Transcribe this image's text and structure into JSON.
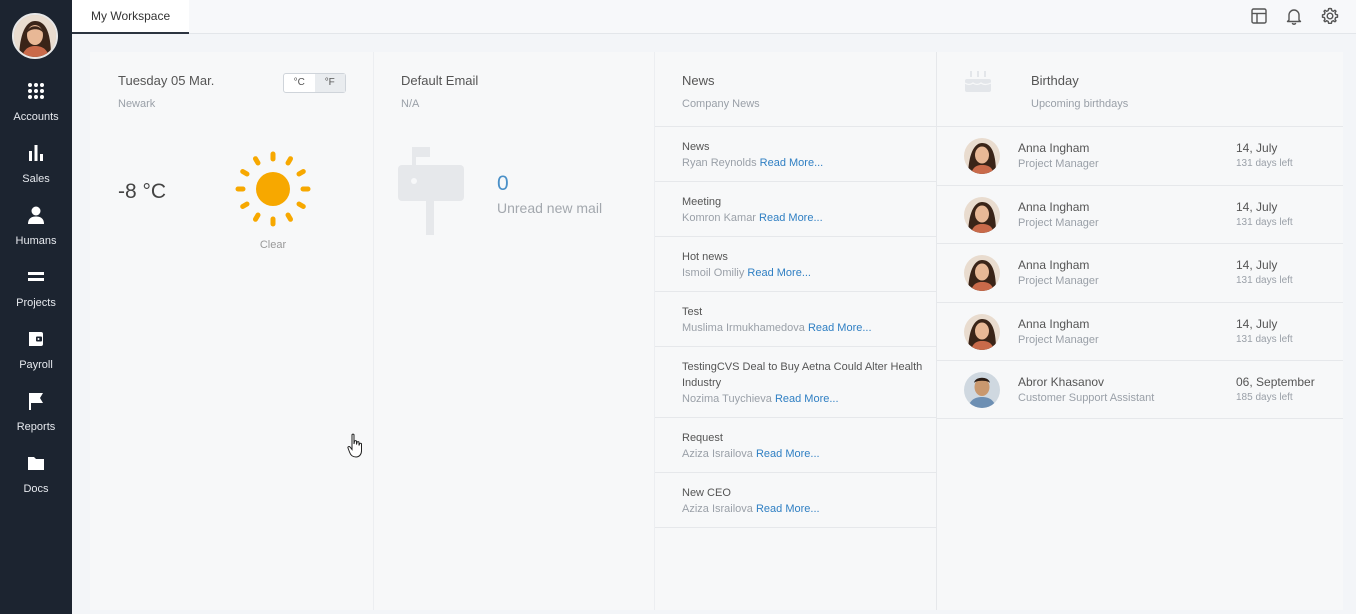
{
  "sidebar": {
    "items": [
      {
        "label": "Accounts",
        "icon": "grid-icon"
      },
      {
        "label": "Sales",
        "icon": "bar-chart-icon"
      },
      {
        "label": "Humans",
        "icon": "person-icon"
      },
      {
        "label": "Projects",
        "icon": "equals-icon"
      },
      {
        "label": "Payroll",
        "icon": "wallet-icon"
      },
      {
        "label": "Reports",
        "icon": "flag-icon"
      },
      {
        "label": "Docs",
        "icon": "folder-icon"
      }
    ]
  },
  "topbar": {
    "tab_label": "My Workspace",
    "icons": [
      "layout-icon",
      "bell-icon",
      "gear-icon"
    ]
  },
  "weather": {
    "date": "Tuesday 05 Mar.",
    "city": "Newark",
    "unit_c": "°C",
    "unit_f": "°F",
    "temperature": "-8 °C",
    "condition": "Clear"
  },
  "email": {
    "title": "Default Email",
    "subtitle": "N/A",
    "count": "0",
    "label": "Unread new mail"
  },
  "news": {
    "title": "News",
    "subtitle": "Company News",
    "read_more": "Read More...",
    "items": [
      {
        "title": "News",
        "author": "Ryan Reynolds"
      },
      {
        "title": "Meeting",
        "author": "Komron Kamar"
      },
      {
        "title": "Hot news",
        "author": "Ismoil Omiliy"
      },
      {
        "title": "Test",
        "author": "Muslima Irmukhamedova"
      },
      {
        "title": "TestingCVS Deal to Buy Aetna Could Alter Health Industry",
        "author": "Nozima Tuychieva"
      },
      {
        "title": "Request",
        "author": "Aziza Israilova"
      },
      {
        "title": "New CEO",
        "author": "Aziza Israilova"
      }
    ]
  },
  "birthday": {
    "title": "Birthday",
    "subtitle": "Upcoming birthdays",
    "items": [
      {
        "name": "Anna Ingham",
        "role": "Project Manager",
        "date": "14, July",
        "left": "131 days left"
      },
      {
        "name": "Anna Ingham",
        "role": "Project Manager",
        "date": "14, July",
        "left": "131 days left"
      },
      {
        "name": "Anna Ingham",
        "role": "Project Manager",
        "date": "14, July",
        "left": "131 days left"
      },
      {
        "name": "Anna Ingham",
        "role": "Project Manager",
        "date": "14, July",
        "left": "131 days left"
      },
      {
        "name": "Abror Khasanov",
        "role": "Customer Support Assistant",
        "date": "06, September",
        "left": "185 days left"
      }
    ]
  },
  "colors": {
    "sidebar_bg": "#1c2430",
    "accent_link": "#2f7fc3",
    "sun": "#f7a800"
  }
}
